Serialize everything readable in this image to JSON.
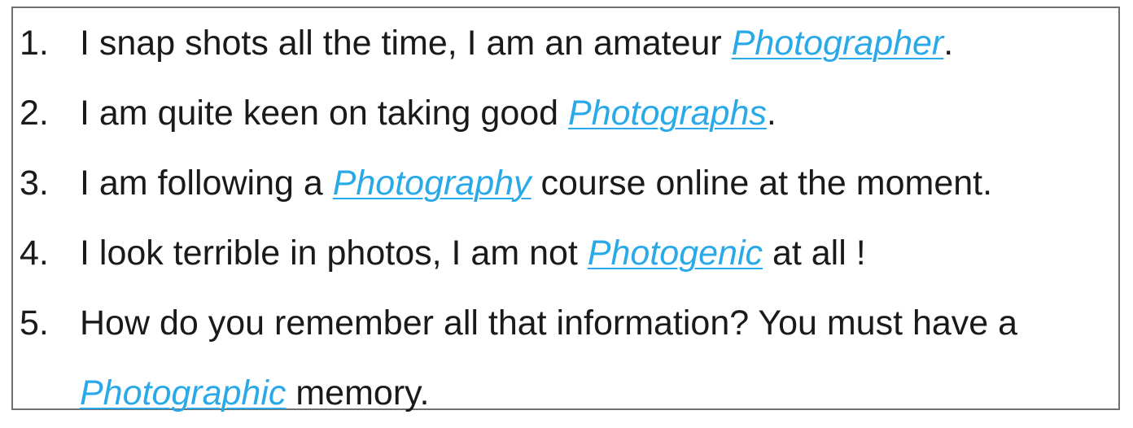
{
  "colors": {
    "keyword": "#29a9e8",
    "text": "#1a1a1a",
    "border": "#707070"
  },
  "sentences": [
    {
      "number": "1.",
      "before": "I snap shots all the time, I am an amateur ",
      "keyword": "Photographer",
      "after": "."
    },
    {
      "number": "2.",
      "before": "I am quite keen on taking good ",
      "keyword": "Photographs",
      "after": "."
    },
    {
      "number": "3.",
      "before": "I am following a ",
      "keyword": "Photography",
      "after": " course online at the moment."
    },
    {
      "number": "4.",
      "before": "I look terrible in photos, I am not ",
      "keyword": "Photogenic",
      "after": " at all !"
    },
    {
      "number": "5.",
      "before": "How do you remember all that information? You must have a ",
      "keyword": "Photographic",
      "after": " memory."
    }
  ]
}
